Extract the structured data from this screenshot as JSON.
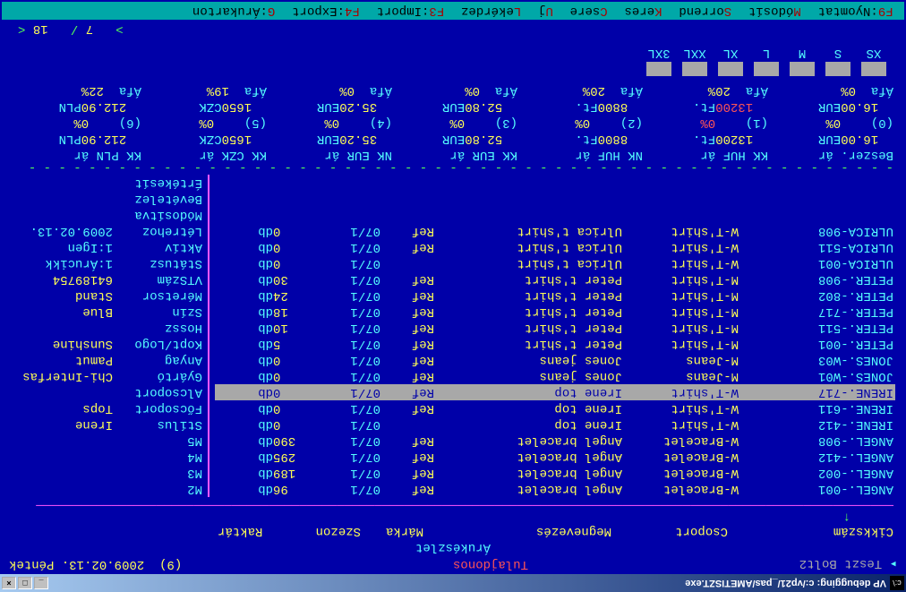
{
  "window": {
    "title": "VP debugging: c:/vp21/_pas/AMETISZT.exe",
    "icon_text": "c:\\"
  },
  "header": {
    "store": "Teszt Bolt2",
    "owner_label": "Tulajdonos",
    "id": "(9)",
    "date": "2009.02.13. Péntek"
  },
  "panel_title": "Árukészlet",
  "columns": {
    "cikk": "Cikkszám",
    "csoport": "Csoport",
    "megnevezes": "Megnevezés",
    "marka": "Márka",
    "szezon": "Szezon",
    "raktar": "Raktár"
  },
  "rows": [
    {
      "code": "ANGEL.-001",
      "group": "W-Bracelet",
      "name": "Angel bracelet",
      "brand": "Ref",
      "season": "07/1",
      "stock": "96",
      "unit": "db"
    },
    {
      "code": "ANGEL.-002",
      "group": "W-Bracelet",
      "name": "Angel bracelet",
      "brand": "Ref",
      "season": "07/1",
      "stock": "189",
      "unit": "db"
    },
    {
      "code": "ANGEL.-412",
      "group": "W-Bracelet",
      "name": "Angel bracelet",
      "brand": "Ref",
      "season": "07/1",
      "stock": "295",
      "unit": "db"
    },
    {
      "code": "ANGEL.-908",
      "group": "W-Bracelet",
      "name": "Angel bracelet",
      "brand": "Ref",
      "season": "07/1",
      "stock": "390",
      "unit": "db"
    },
    {
      "code": "IRENE.-412",
      "group": "W-T'shirt",
      "name": "Irene top",
      "brand": "",
      "season": "07/1",
      "stock": "0",
      "unit": "db"
    },
    {
      "code": "IRENE.-611",
      "group": "W-T'shirt",
      "name": "Irene top",
      "brand": "Ref",
      "season": "07/1",
      "stock": "0",
      "unit": "db"
    },
    {
      "code": "IRENE.-717",
      "group": "W-T'shirt",
      "name": "Irene top",
      "brand": "Ref",
      "season": "07/1",
      "stock": "0",
      "unit": "db",
      "selected": true
    },
    {
      "code": "JONES.-W01",
      "group": "M-Jeans",
      "name": "Jones jeans",
      "brand": "Ref",
      "season": "07/1",
      "stock": "0",
      "unit": "db"
    },
    {
      "code": "JONES.-W03",
      "group": "M-Jeans",
      "name": "Jones jeans",
      "brand": "Ref",
      "season": "07/1",
      "stock": "0",
      "unit": "db"
    },
    {
      "code": "PETER.-001",
      "group": "M-T'shirt",
      "name": "Peter t'shirt",
      "brand": "Ref",
      "season": "07/1",
      "stock": "5",
      "unit": "db"
    },
    {
      "code": "PETER.-511",
      "group": "M-T'shirt",
      "name": "Peter t'shirt",
      "brand": "Ref",
      "season": "07/1",
      "stock": "10",
      "unit": "db"
    },
    {
      "code": "PETER.-717",
      "group": "M-T'shirt",
      "name": "Peter t'shirt",
      "brand": "Ref",
      "season": "07/1",
      "stock": "18",
      "unit": "db"
    },
    {
      "code": "PETER.-802",
      "group": "M-T'shirt",
      "name": "Peter t'shirt",
      "brand": "Ref",
      "season": "07/1",
      "stock": "24",
      "unit": "db"
    },
    {
      "code": "PETER.-908",
      "group": "M-T'shirt",
      "name": "Peter t'shirt",
      "brand": "Ref",
      "season": "07/1",
      "stock": "30",
      "unit": "db"
    },
    {
      "code": "ULRICA-001",
      "group": "W-T'shirt",
      "name": "Ulrica t'shirt",
      "brand": "",
      "season": "07/1",
      "stock": "0",
      "unit": "db"
    },
    {
      "code": "ULRICA-511",
      "group": "W-T'shirt",
      "name": "Ulrica t'shirt",
      "brand": "Ref",
      "season": "07/1",
      "stock": "0",
      "unit": "db"
    },
    {
      "code": "ULRICA-908",
      "group": "W-T'shirt",
      "name": "Ulrica t'shirt",
      "brand": "Ref",
      "season": "07/1",
      "stock": "0",
      "unit": "db"
    }
  ],
  "info": [
    {
      "label": "M2",
      "value": ""
    },
    {
      "label": "M3",
      "value": ""
    },
    {
      "label": "M4",
      "value": ""
    },
    {
      "label": "M5",
      "value": ""
    },
    {
      "label": "Stílus",
      "value": "Irene"
    },
    {
      "label": "Főcsoport",
      "value": "Tops"
    },
    {
      "label": "Alcsoport",
      "value": ""
    },
    {
      "label": "Gyártó",
      "value": "Chi-Interfas"
    },
    {
      "label": "Anyag",
      "value": "Pamut"
    },
    {
      "label": "Kopt/Logo",
      "value": "Sunshine"
    },
    {
      "label": "Hossz",
      "value": ""
    },
    {
      "label": "Szín",
      "value": "Blue"
    },
    {
      "label": "Méretsor",
      "value": "Stand"
    },
    {
      "label": "VTSzám",
      "value": "64189754"
    },
    {
      "label": "Státusz",
      "value": "1:Árucikk",
      "cyan": true
    },
    {
      "label": "Aktív",
      "value": "1:Igen",
      "cyan": true
    },
    {
      "label": "Létrehoz",
      "value": "2009.02.13.",
      "cyan": true
    },
    {
      "label": "Módosítva",
      "value": ""
    },
    {
      "label": "Bevételez",
      "value": ""
    },
    {
      "label": "Értékesít",
      "value": ""
    }
  ],
  "prices": {
    "labels": [
      "Beszer. ár",
      "KK HUF ár",
      "NK HUF ár",
      "KK EUR ár",
      "NK EUR ár",
      "KK CZK ár",
      "KK PLN ár"
    ],
    "values": [
      {
        "num": "16.00",
        "cur": "EUR"
      },
      {
        "num": "13200",
        "cur": "Ft."
      },
      {
        "num": "8800",
        "cur": "Ft."
      },
      {
        "num": "52.80",
        "cur": "EUR"
      },
      {
        "num": "35.20",
        "cur": "EUR"
      },
      {
        "num": "1650",
        "cur": "CZK"
      },
      {
        "num": "212.90",
        "cur": "PLN"
      }
    ],
    "idx": [
      {
        "i": "(0)",
        "pct": "0%"
      },
      {
        "i": "(1)",
        "pct": "0%",
        "red": true
      },
      {
        "i": "(2)",
        "pct": "0%"
      },
      {
        "i": "(3)",
        "pct": "0%"
      },
      {
        "i": "(4)",
        "pct": "0%"
      },
      {
        "i": "(5)",
        "pct": "0%"
      },
      {
        "i": "(6)",
        "pct": "0%"
      }
    ],
    "values2": [
      {
        "num": "16.00",
        "cur": "EUR"
      },
      {
        "num": "13200",
        "cur": "Ft.",
        "red": true
      },
      {
        "num": "8800",
        "cur": "Ft."
      },
      {
        "num": "52.80",
        "cur": "EUR"
      },
      {
        "num": "35.20",
        "cur": "EUR"
      },
      {
        "num": "1650",
        "cur": "CZK"
      },
      {
        "num": "212.90",
        "cur": "PLN"
      }
    ],
    "afa": [
      {
        "l": "Áfa",
        "v": "0%"
      },
      {
        "l": "Áfa",
        "v": "20%"
      },
      {
        "l": "Áfa",
        "v": "20%"
      },
      {
        "l": "Áfa",
        "v": "0%"
      },
      {
        "l": "Áfa",
        "v": "0%"
      },
      {
        "l": "Áfa",
        "v": "19%"
      },
      {
        "l": "Áfa",
        "v": "22%"
      }
    ]
  },
  "sizes": [
    "XS",
    "S",
    "M",
    "L",
    "XL",
    "XXL",
    "3XL"
  ],
  "pager": {
    "cur": "7",
    "sep": "/",
    "total": "18"
  },
  "menu": [
    {
      "k": "F9",
      "t": ":Nyomtat"
    },
    {
      "k": "M",
      "t": "ódosít"
    },
    {
      "k": "S",
      "t": "orrend"
    },
    {
      "k": "K",
      "t": "eres"
    },
    {
      "k": "C",
      "t": "sere"
    },
    {
      "k": "U",
      "t": "j"
    },
    {
      "k": "L",
      "t": "ekérdez"
    },
    {
      "k": "F3",
      "t": ":Import"
    },
    {
      "k": "F4",
      "t": ":Export"
    },
    {
      "k": "G",
      "t": ":Árukarton"
    }
  ]
}
